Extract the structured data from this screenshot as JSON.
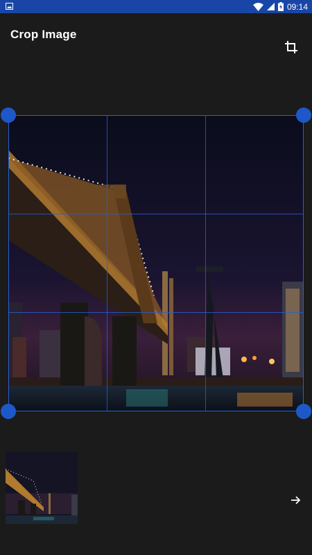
{
  "status_bar": {
    "time": "09:14",
    "left_icon": "image-icon",
    "icons": [
      "wifi-icon",
      "signal-icon",
      "battery-icon"
    ]
  },
  "app_bar": {
    "title": "Crop Image",
    "action_icon": "crop-icon"
  },
  "crop": {
    "grid": "3x3",
    "handles": [
      "top-left",
      "top-right",
      "bottom-left",
      "bottom-right"
    ],
    "frame_color": "#2b5ed1",
    "handle_color": "#1e58c8"
  },
  "footer": {
    "thumbnail_icon": "image-thumbnail",
    "next_icon": "arrow-right-icon"
  },
  "colors": {
    "status_bar": "#1946a6",
    "background": "#1b1b1b"
  }
}
